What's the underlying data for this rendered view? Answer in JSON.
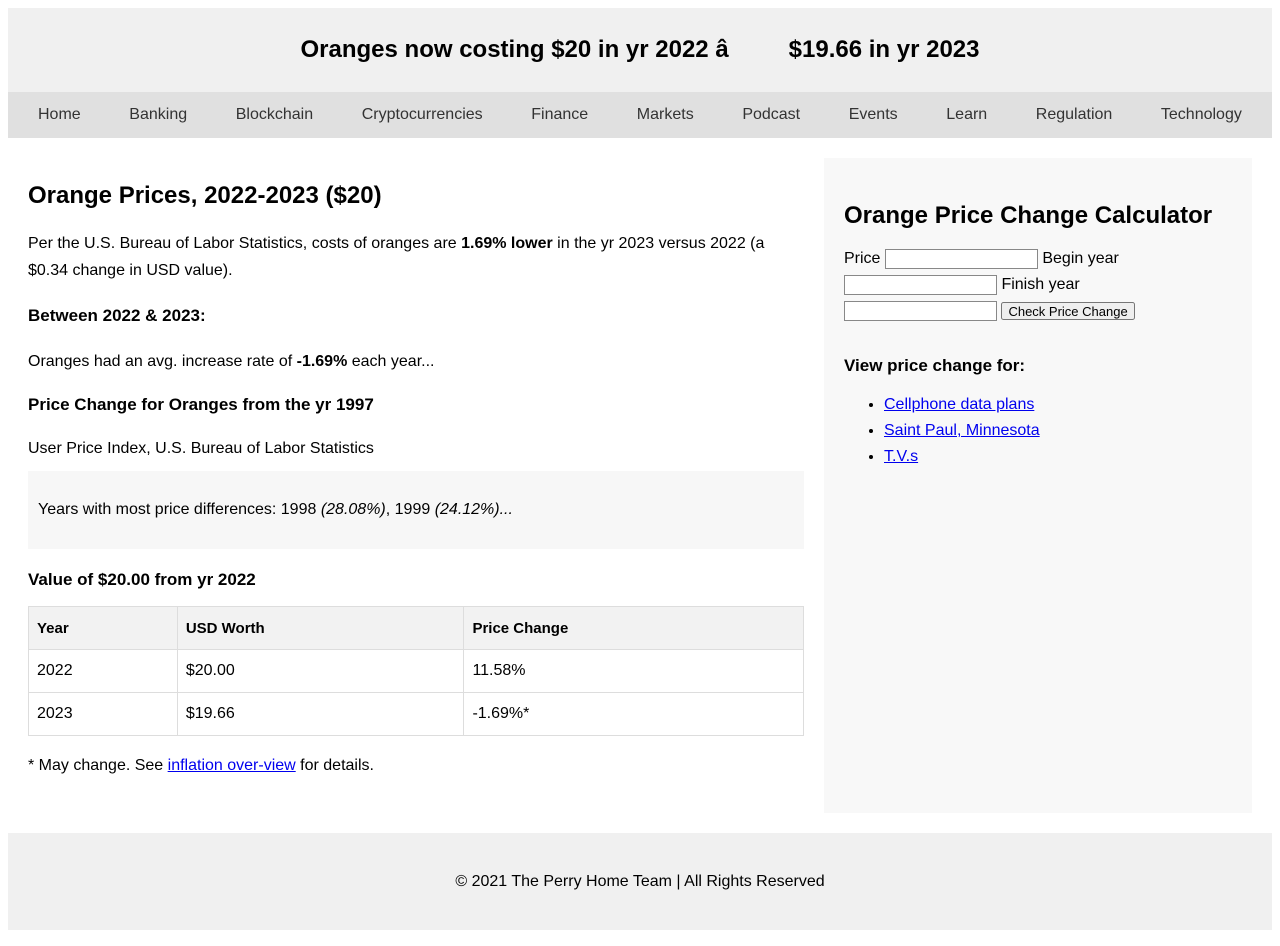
{
  "banner": {
    "title": "Oranges now costing $20 in yr 2022 â         $19.66 in yr 2023"
  },
  "nav": {
    "items": [
      "Home",
      "Banking",
      "Blockchain",
      "Cryptocurrencies",
      "Finance",
      "Markets",
      "Podcast",
      "Events",
      "Learn",
      "Regulation",
      "Technology"
    ]
  },
  "article": {
    "heading": "Orange Prices, 2022-2023 ($20)",
    "intro": {
      "pre": "Per the U.S. Bureau of Labor Statistics, costs of oranges are ",
      "bold": "1.69% lower",
      "post": " in the yr 2023 versus 2022 (a $0.34 change in USD value)."
    },
    "between_heading": "Between 2022 & 2023:",
    "avg": {
      "pre": "Oranges had an avg. increase rate of ",
      "bold": "-1.69%",
      "post": " each year..."
    },
    "since_heading": "Price Change for Oranges from the yr 1997",
    "source": "User Price Index, U.S. Bureau of Labor Statistics",
    "highlight": {
      "pre": "Years with most price differences: 1998 ",
      "em1": "(28.08%)",
      "mid": ", 1999 ",
      "em2": "(24.12%)...",
      "post": ""
    },
    "value_heading": "Value of $20.00 from yr 2022",
    "table": {
      "headers": [
        "Year",
        "USD Worth",
        "Price Change"
      ],
      "rows": [
        [
          "2022",
          "$20.00",
          "11.58%"
        ],
        [
          "2023",
          "$19.66",
          "-1.69%*"
        ]
      ]
    },
    "note": {
      "pre": "* May change. See ",
      "link": "inflation over-view",
      "post": " for details."
    }
  },
  "sidebar": {
    "heading": "Orange Price Change Calculator",
    "price_label": "Price",
    "begin_label": "Begin year",
    "finish_label": "Finish year",
    "button": "Check Price Change",
    "inputs": {
      "price": "",
      "begin": "",
      "finish": ""
    },
    "view_heading": "View price change for:",
    "links": [
      "Cellphone data plans",
      "Saint Paul, Minnesota",
      "T.V.s"
    ]
  },
  "footer": {
    "text": "© 2021 The Perry Home Team | All Rights Reserved"
  }
}
